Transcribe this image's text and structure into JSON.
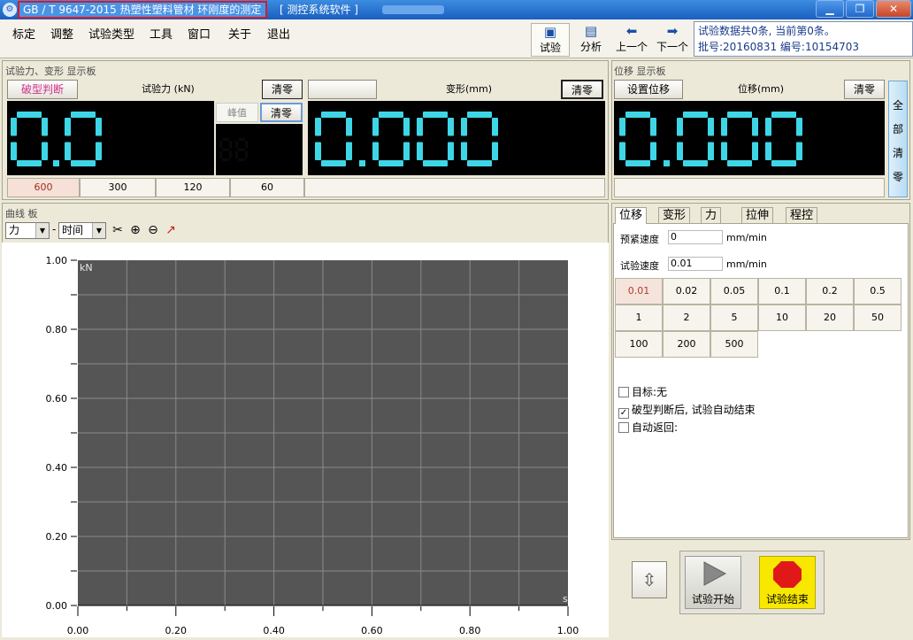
{
  "window": {
    "title": "GB / T 9647-2015 热塑性塑料管材 环刚度的测定",
    "subtitle": "[ 测控系统软件 ]",
    "controls": [
      "▁",
      "❐",
      "✕"
    ]
  },
  "menu": [
    "标定",
    "调整",
    "试验类型",
    "工具",
    "窗口",
    "关于",
    "退出"
  ],
  "toolbar": {
    "test": "试验",
    "analysis": "分析",
    "prev": "上一个",
    "next": "下一个"
  },
  "info": {
    "line1": "试验数据共0条, 当前第0条。",
    "line2": "批号:20160831  编号:10154703"
  },
  "force_panel": {
    "title": "试验力、变形 显示板",
    "break_judge": "破型判断",
    "force_label": "试验力 (kN)",
    "clear": "清零",
    "peak": "峰值",
    "peak_clear": "清零",
    "deform_label": "变形(mm)",
    "deform_clear": "清零",
    "force_value": "0.0",
    "deform_value": "0.000",
    "ranges": [
      "600",
      "300",
      "120",
      "60"
    ],
    "selected_range": "600"
  },
  "disp_panel": {
    "title": "位移 显示板",
    "set": "设置位移",
    "label": "位移(mm)",
    "clear": "清零",
    "value": "0.000",
    "all_clear": [
      "全",
      "部",
      "清",
      "零"
    ]
  },
  "curve_panel": {
    "title": "曲线 板",
    "y_select": "力",
    "x_select": "时间",
    "icons": [
      "tools-icon",
      "zoom-in-icon",
      "zoom-out-icon",
      "auto-scale-icon"
    ]
  },
  "chart_data": {
    "type": "line",
    "series": [],
    "ylabel": "kN",
    "xlabel": "s",
    "xlim": [
      0,
      1
    ],
    "ylim": [
      0,
      1
    ],
    "x_ticks": [
      "0.00",
      "0.20",
      "0.40",
      "0.60",
      "0.80",
      "1.00"
    ],
    "y_ticks": [
      "0.00",
      "0.20",
      "0.40",
      "0.60",
      "0.80",
      "1.00"
    ],
    "grid": true,
    "background": "#555555"
  },
  "control_panel": {
    "tabs": [
      "位移",
      "变形",
      "力",
      "拉伸",
      "程控"
    ],
    "active_tab": "位移",
    "preload_label": "预紧速度",
    "preload_value": "0",
    "preload_unit": "mm/min",
    "test_speed_label": "试验速度",
    "test_speed_value": "0.01",
    "test_speed_unit": "mm/min",
    "speeds": [
      "0.01",
      "0.02",
      "0.05",
      "0.1",
      "0.2",
      "0.5",
      "1",
      "2",
      "5",
      "10",
      "20",
      "50",
      "100",
      "200",
      "500"
    ],
    "selected_speed": "0.01",
    "checks": [
      {
        "label": "目标:无",
        "checked": false
      },
      {
        "label": "破型判断后, 试验自动结束",
        "checked": true
      },
      {
        "label": "自动返回:",
        "checked": false
      }
    ]
  },
  "actions": {
    "start": "试验开始",
    "stop": "试验结束"
  }
}
